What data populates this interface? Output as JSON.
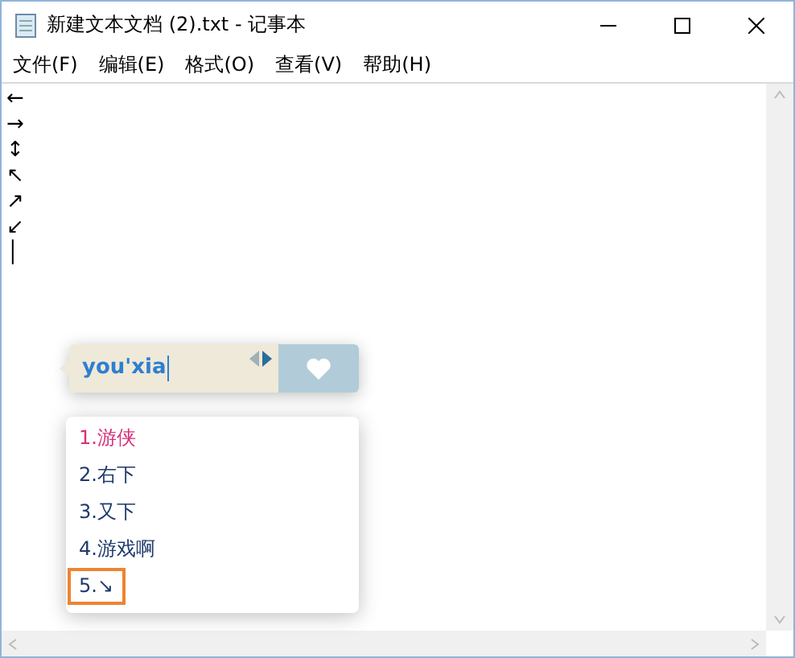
{
  "window": {
    "title": "新建文本文档 (2).txt - 记事本"
  },
  "menu": [
    "文件(F)",
    "编辑(E)",
    "格式(O)",
    "查看(V)",
    "帮助(H)"
  ],
  "document": {
    "lines": [
      "←",
      "→",
      "↕",
      "↖",
      "↗",
      "↙",
      "│"
    ]
  },
  "ime": {
    "composition": "you'xia",
    "prev_page": {
      "disabled": true
    },
    "next_page": {
      "disabled": false
    },
    "candidates": [
      {
        "label": "1.游侠",
        "selected": true,
        "hovered": false
      },
      {
        "label": "2.右下",
        "selected": false,
        "hovered": false
      },
      {
        "label": "3.又下",
        "selected": false,
        "hovered": false
      },
      {
        "label": "4.游戏啊",
        "selected": false,
        "hovered": false
      },
      {
        "label": "5.↘",
        "selected": false,
        "hovered": true
      }
    ]
  }
}
